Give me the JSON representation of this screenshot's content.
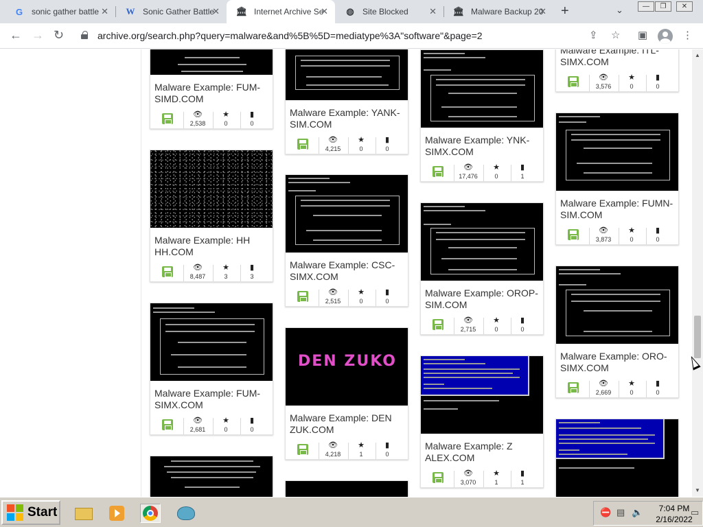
{
  "browser": {
    "tabs": [
      {
        "label": "sonic gather battle",
        "icon": "google-icon",
        "active": false
      },
      {
        "label": "Sonic Gather Battle",
        "icon": "wikipedia-icon",
        "active": false
      },
      {
        "label": "Internet Archive Se",
        "icon": "archive-icon",
        "active": true
      },
      {
        "label": "Site Blocked",
        "icon": "globe-icon",
        "active": false
      },
      {
        "label": "Malware Backup 20",
        "icon": "archive-icon",
        "active": false
      }
    ],
    "url": "archive.org/search.php?query=malware&and%5B%5D=mediatype%3A\"software\"&page=2"
  },
  "results": {
    "columns": [
      [
        {
          "title": "Malware Example: FUM-SIMD.COM",
          "views": "2,538",
          "favorites": "0",
          "reviews": "0"
        },
        {
          "title": "Malware Example: HH HH.COM",
          "views": "8,487",
          "favorites": "3",
          "reviews": "3"
        },
        {
          "title": "Malware Example: FUM-SIMX.COM",
          "views": "2,681",
          "favorites": "0",
          "reviews": "0"
        }
      ],
      [
        {
          "title": "Malware Example: YANK-SIM.COM",
          "views": "4,215",
          "favorites": "0",
          "reviews": "0"
        },
        {
          "title": "Malware Example: CSC-SIMX.COM",
          "views": "2,515",
          "favorites": "0",
          "reviews": "0"
        },
        {
          "title": "Malware Example: DEN ZUK.COM",
          "views": "4,218",
          "favorites": "1",
          "reviews": "0",
          "thumb_text": "DEN ZUKO"
        }
      ],
      [
        {
          "title": "Malware Example: YNK-SIMX.COM",
          "views": "17,476",
          "favorites": "0",
          "reviews": "1"
        },
        {
          "title": "Malware Example: OROP-SIM.COM",
          "views": "2,715",
          "favorites": "0",
          "reviews": "0"
        },
        {
          "title": "Malware Example: Z ALEX.COM",
          "views": "3,070",
          "favorites": "1",
          "reviews": "1"
        }
      ],
      [
        {
          "title": "Malware Example: ITL-SIMX.COM",
          "views": "3,576",
          "favorites": "0",
          "reviews": "0"
        },
        {
          "title": "Malware Example: FUMN-SIM.COM",
          "views": "3,873",
          "favorites": "0",
          "reviews": "0"
        },
        {
          "title": "Malware Example: ORO-SIMX.COM",
          "views": "2,669",
          "favorites": "0",
          "reviews": "0"
        }
      ]
    ]
  },
  "taskbar": {
    "start_label": "Start",
    "time": "7:04 PM",
    "date": "2/16/2022"
  },
  "colors": {
    "tab_strip": "#dee1e6",
    "software_icon": "#78b94a",
    "denzuko_pink": "#e14fc8",
    "dos_blue": "#0000aa",
    "taskbar": "#d4d0c8"
  }
}
